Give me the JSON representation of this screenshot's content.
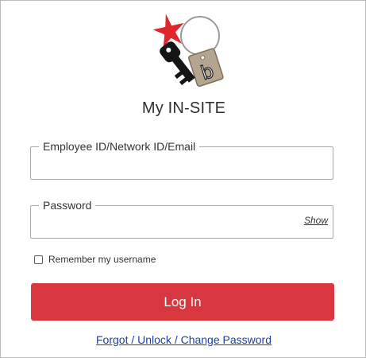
{
  "header": {
    "title": "My IN-SITE",
    "logo_icon": "keychain-star-logo-icon",
    "logo_tag_letter": "b"
  },
  "form": {
    "username_label": "Employee ID/Network ID/Email",
    "username_value": "",
    "password_label": "Password",
    "password_value": "",
    "show_label": "Show",
    "remember_label": "Remember my username",
    "remember_checked": false,
    "login_label": "Log In",
    "forgot_label": "Forgot / Unlock / Change Password"
  },
  "colors": {
    "accent": "#d9373f",
    "link": "#1a3fa6",
    "star": "#e0262c"
  }
}
